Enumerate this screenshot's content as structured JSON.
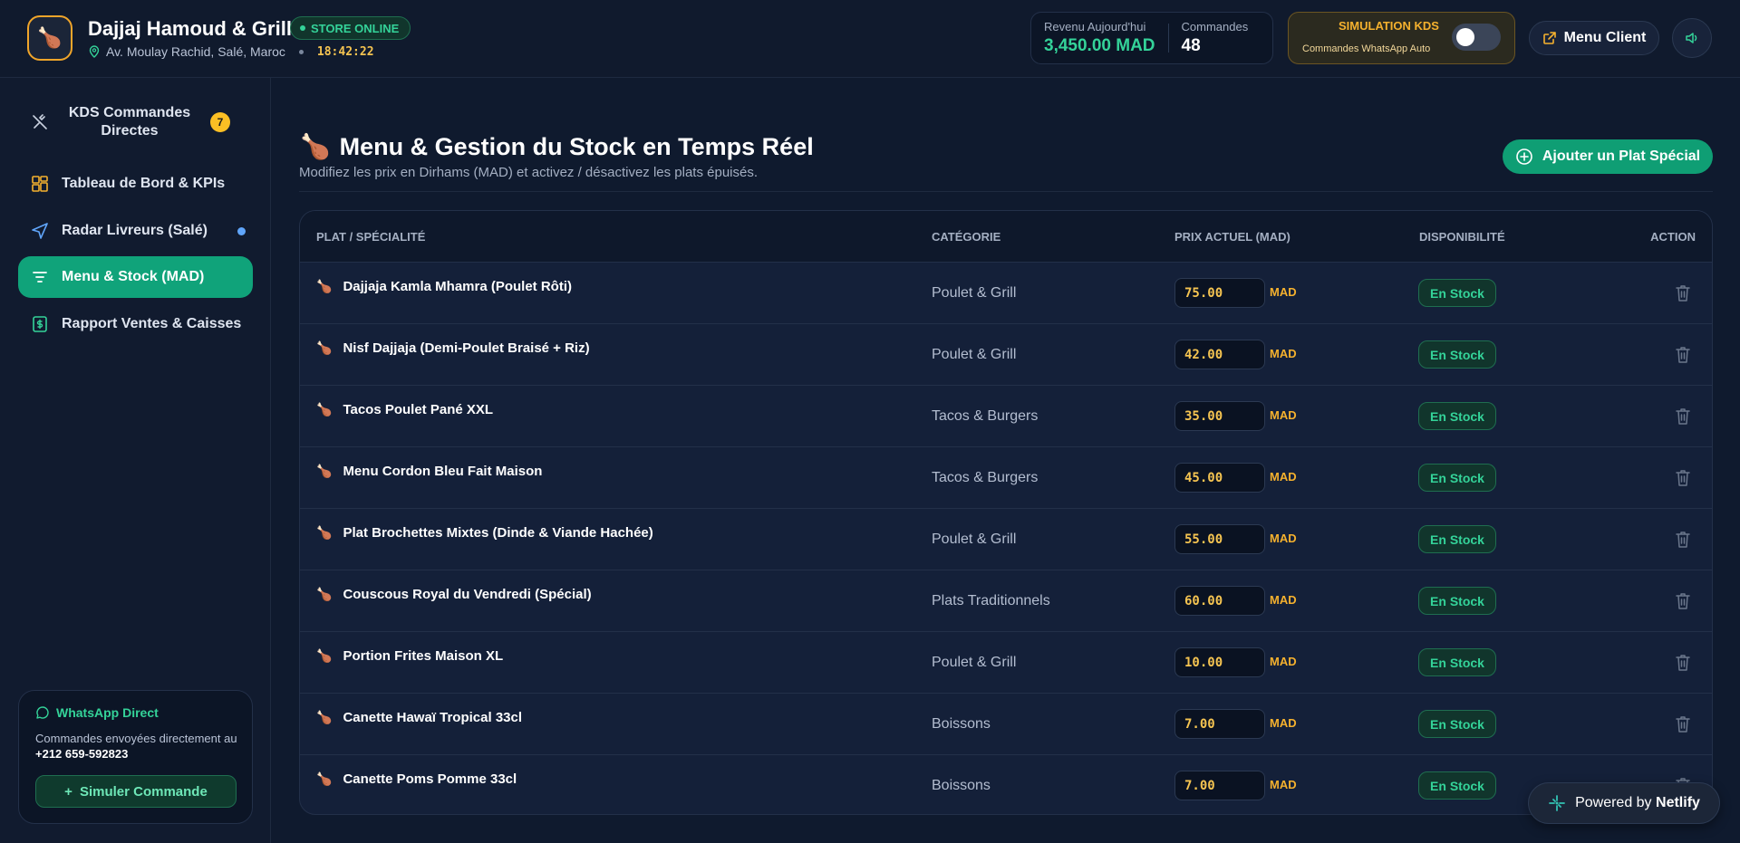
{
  "header": {
    "brand_name": "Dajjaj Hamoud & Grill",
    "store_status": "STORE ONLINE",
    "address": "Av. Moulay Rachid, Salé, Maroc",
    "clock": "18:42:22",
    "revenue_label": "Revenu Aujourd'hui",
    "revenue_value": "3,450.00 MAD",
    "orders_label": "Commandes",
    "orders_value": "48",
    "sim_title": "SIMULATION KDS",
    "sim_subtitle": "Commandes WhatsApp Auto",
    "sim_enabled": false,
    "menu_client_label": "Menu Client"
  },
  "sidebar": {
    "items": [
      {
        "label": "KDS Commandes Directes",
        "badge": "7"
      },
      {
        "label": "Tableau de Bord & KPIs"
      },
      {
        "label": "Radar Livreurs (Salé)"
      },
      {
        "label": "Menu & Stock (MAD)",
        "active": true
      },
      {
        "label": "Rapport Ventes & Caisses"
      }
    ],
    "whatsapp": {
      "title": "WhatsApp Direct",
      "text": "Commandes envoyées directement au",
      "phone": "+212 659-592823",
      "button_label": "Simuler Commande"
    }
  },
  "main": {
    "title": "Menu & Gestion du Stock en Temps Réel",
    "subtitle": "Modifiez les prix en Dirhams (MAD) et activez / désactivez les plats épuisés.",
    "add_button_label": "Ajouter un Plat Spécial",
    "columns": [
      "PLAT / SPÉCIALITÉ",
      "CATÉGORIE",
      "PRIX ACTUEL (MAD)",
      "DISPONIBILITÉ",
      "ACTION"
    ],
    "currency": "MAD",
    "rows": [
      {
        "name": "Dajjaja Kamla Mhamra (Poulet Rôti)",
        "category": "Poulet & Grill",
        "price": "75.00",
        "status": "En Stock"
      },
      {
        "name": "Nisf Dajjaja (Demi-Poulet Braisé + Riz)",
        "category": "Poulet & Grill",
        "price": "42.00",
        "status": "En Stock"
      },
      {
        "name": "Tacos Poulet Pané XXL",
        "category": "Tacos & Burgers",
        "price": "35.00",
        "status": "En Stock"
      },
      {
        "name": "Menu Cordon Bleu Fait Maison",
        "category": "Tacos & Burgers",
        "price": "45.00",
        "status": "En Stock"
      },
      {
        "name": "Plat Brochettes Mixtes (Dinde & Viande Hachée)",
        "category": "Poulet & Grill",
        "price": "55.00",
        "status": "En Stock"
      },
      {
        "name": "Couscous Royal du Vendredi (Spécial)",
        "category": "Plats Traditionnels",
        "price": "60.00",
        "status": "En Stock"
      },
      {
        "name": "Portion Frites Maison XL",
        "category": "Poulet & Grill",
        "price": "10.00",
        "status": "En Stock"
      },
      {
        "name": "Canette Hawaï Tropical 33cl",
        "category": "Boissons",
        "price": "7.00",
        "status": "En Stock"
      },
      {
        "name": "Canette Poms Pomme 33cl",
        "category": "Boissons",
        "price": "7.00",
        "status": "En Stock"
      }
    ]
  },
  "footer": {
    "netlify_prefix": "Powered by",
    "netlify_brand": "Netlify"
  },
  "colors": {
    "accent": "#10a37a",
    "warning": "#f5c451",
    "background": "#0f1a2e"
  }
}
